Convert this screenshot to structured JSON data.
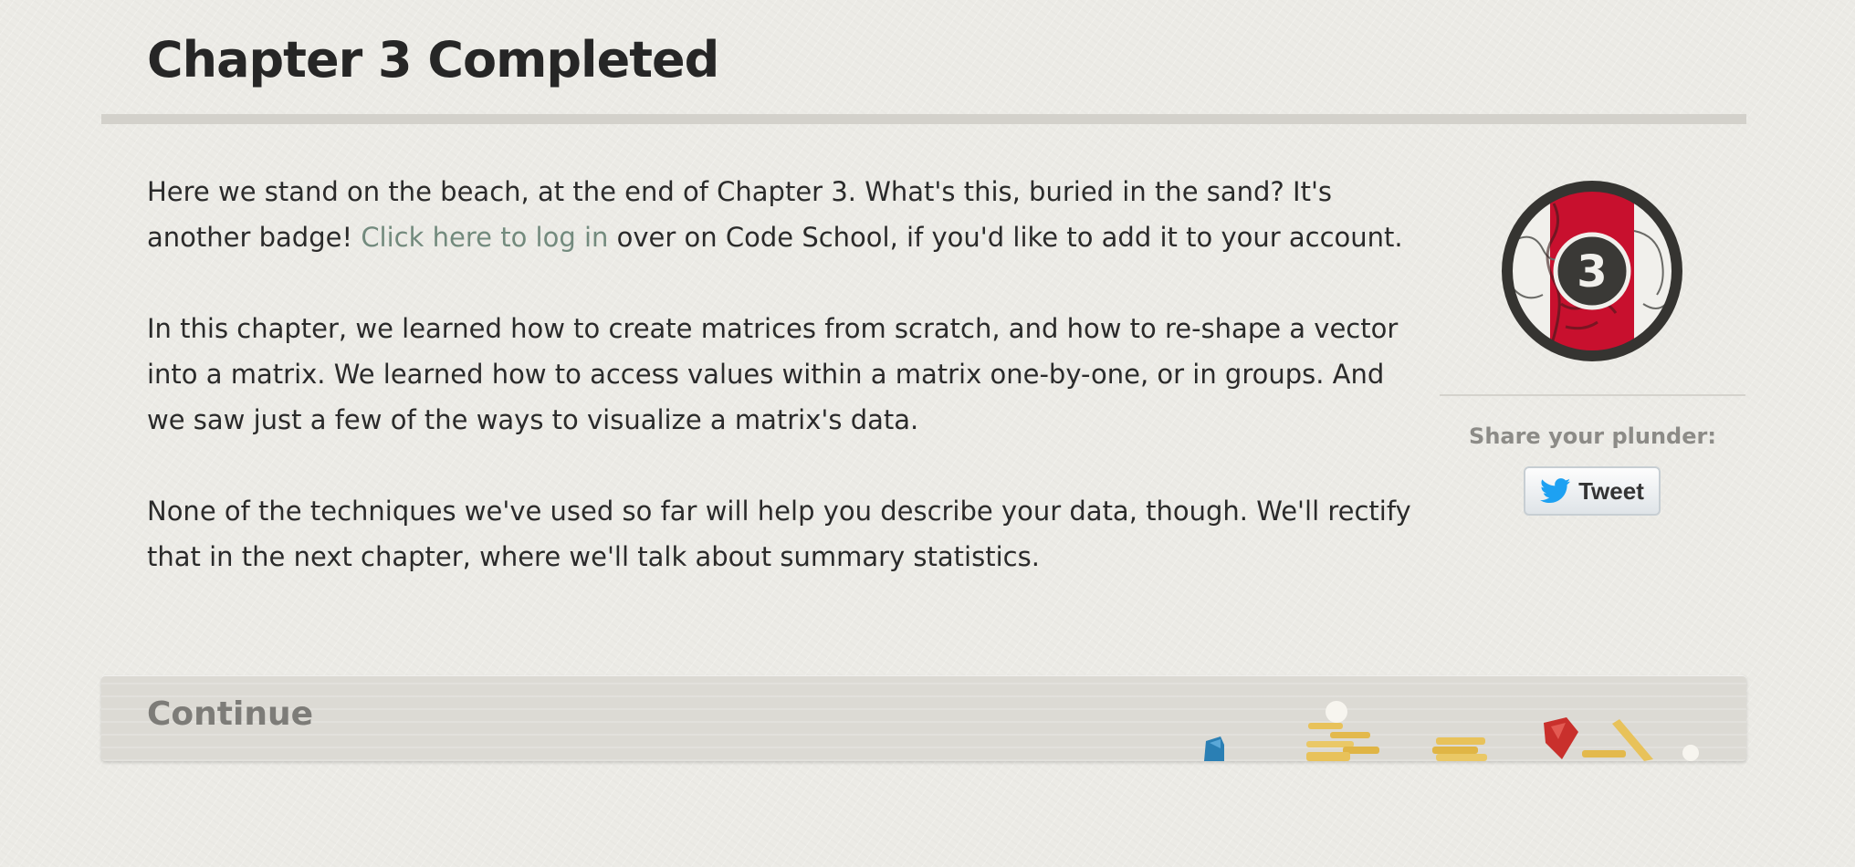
{
  "page": {
    "title": "Chapter 3 Completed"
  },
  "content": {
    "paragraph1_before": "Here we stand on the beach, at the end of Chapter 3. What's this, buried in the sand? It's another badge! ",
    "login_link": "Click here to log in",
    "paragraph1_after": " over on Code School, if you'd like to add it to your account.",
    "paragraph2": "In this chapter, we learned how to create matrices from scratch, and how to re-shape a vector into a matrix. We learned how to access values within a matrix one-by-one, or in groups. And we saw just a few of the ways to visualize a matrix's data.",
    "paragraph3": "None of the techniques we've used so far will help you describe your data, though. We'll rectify that in the next chapter, where we'll talk about summary statistics."
  },
  "sidebar": {
    "badge_number": "3",
    "badge_icon": "chapter-badge-icon",
    "share_label": "Share your plunder:",
    "tweet_label": "Tweet",
    "tweet_icon": "twitter-bird-icon"
  },
  "footer": {
    "continue_label": "Continue",
    "decoration": "treasure-pile-illustration"
  },
  "colors": {
    "background": "#ecebe6",
    "link": "#728a7d",
    "badge_red": "#c8102e",
    "badge_ring": "#353431",
    "twitter_blue": "#1da1f2",
    "gold": "#e8c25a",
    "ruby": "#c9302c",
    "sapphire": "#2a7fb4"
  }
}
